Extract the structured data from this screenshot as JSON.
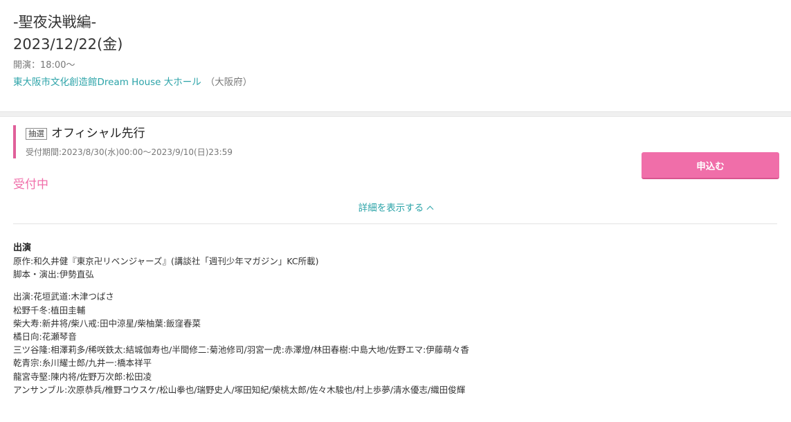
{
  "event": {
    "subtitle": "-聖夜決戦編-",
    "date": "2023/12/22(金)",
    "start_time": "開演：18:00〜",
    "venue": "東大阪市文化創造館Dream House 大ホール",
    "prefecture": "（大阪府）"
  },
  "sale": {
    "badge": "抽選",
    "name": "オフィシャル先行",
    "period": "受付期間:2023/8/30(水)00:00〜2023/9/10(日)23:59",
    "status": "受付中",
    "apply_label": "申込む",
    "details_toggle_label": "詳細を表示する"
  },
  "colors": {
    "accent_pink": "#f06ea9",
    "link_teal": "#2ba3a8"
  },
  "cast": {
    "heading": "出演",
    "credits": [
      "原作:和久井健『東京卍リベンジャーズ』(講談社「週刊少年マガジン」KC所載)",
      "脚本・演出:伊勢直弘"
    ],
    "performers": [
      "出演:花垣武道:木津つばさ",
      "松野千冬:植田圭輔",
      "柴大寿:新井将/柴八戒:田中涼星/柴柚葉:飯窪春菜",
      "橘日向:花瀬琴音",
      "三ツ谷隆:相澤莉多/稀咲鉄太:結城伽寿也/半間修二:菊池修司/羽宮一虎:赤澤燈/林田春樹:中島大地/佐野エマ:伊藤萌々香",
      "乾青宗:糸川耀士郎/九井一:橋本祥平",
      "龍宮寺堅:陳内将/佐野万次郎:松田凌",
      "アンサンブル:次原恭兵/椎野コウスケ/松山拳也/瑞野史人/塚田知紀/榮桃太郎/佐々木駿也/村上歩夢/清水優志/織田俊輝"
    ]
  }
}
